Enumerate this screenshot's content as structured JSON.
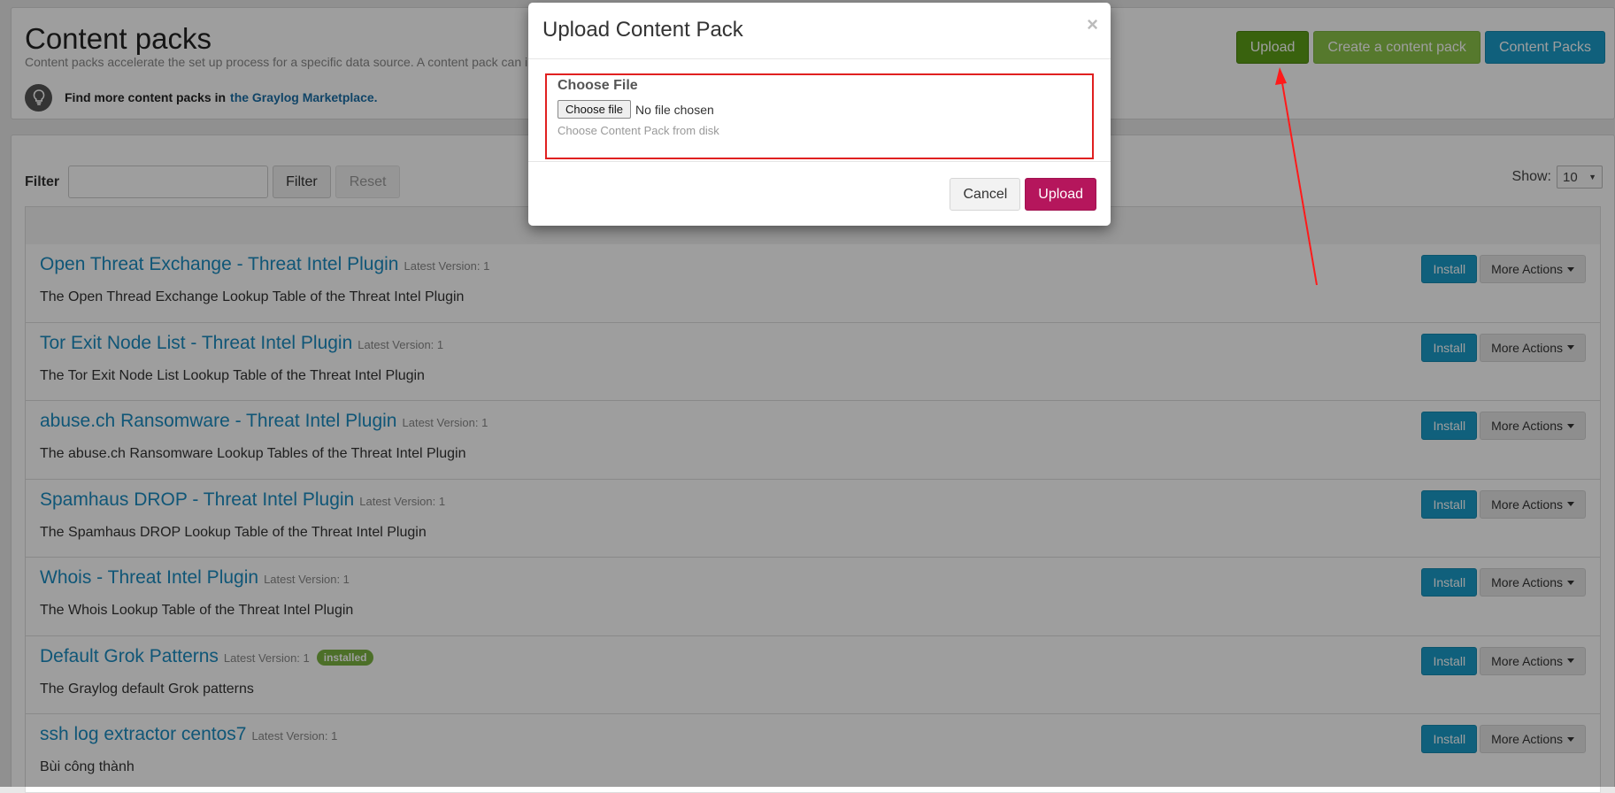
{
  "header": {
    "title": "Content packs",
    "description": "Content packs accelerate the set up process for a specific data source. A content pack can include inputs/extractors, streams, and dashboards.",
    "marketplace_text": "Find more content packs in",
    "marketplace_link": "the Graylog Marketplace.",
    "buttons": {
      "upload": "Upload",
      "create": "Create a content pack",
      "packs": "Content Packs"
    }
  },
  "filter": {
    "label": "Filter",
    "input_value": "",
    "filter_button": "Filter",
    "reset_button": "Reset",
    "show_label": "Show:",
    "show_value": "10"
  },
  "rows": [
    {
      "name": "Open Threat Exchange - Threat Intel Plugin",
      "version": "Latest Version: 1",
      "badge": "",
      "desc": "The Open Thread Exchange Lookup Table of the Threat Intel Plugin"
    },
    {
      "name": "Tor Exit Node List - Threat Intel Plugin",
      "version": "Latest Version: 1",
      "badge": "",
      "desc": "The Tor Exit Node List Lookup Table of the Threat Intel Plugin"
    },
    {
      "name": "abuse.ch Ransomware - Threat Intel Plugin",
      "version": "Latest Version: 1",
      "badge": "",
      "desc": "The abuse.ch Ransomware Lookup Tables of the Threat Intel Plugin"
    },
    {
      "name": "Spamhaus DROP - Threat Intel Plugin",
      "version": "Latest Version: 1",
      "badge": "",
      "desc": "The Spamhaus DROP Lookup Table of the Threat Intel Plugin"
    },
    {
      "name": "Whois - Threat Intel Plugin",
      "version": "Latest Version: 1",
      "badge": "",
      "desc": "The Whois Lookup Table of the Threat Intel Plugin"
    },
    {
      "name": "Default Grok Patterns",
      "version": "Latest Version: 1",
      "badge": "installed",
      "desc": "The Graylog default Grok patterns"
    },
    {
      "name": "ssh log extractor centos7",
      "version": "Latest Version: 1",
      "badge": "",
      "desc": "Bùi công thành"
    }
  ],
  "row_actions": {
    "install": "Install",
    "more": "More Actions"
  },
  "modal": {
    "title": "Upload Content Pack",
    "close": "×",
    "field_label": "Choose File",
    "file_button": "Choose file",
    "file_status": "No file chosen",
    "help": "Choose Content Pack from disk",
    "cancel": "Cancel",
    "upload": "Upload"
  },
  "colors": {
    "accent_blue": "#1a9bc8",
    "upload_pink": "#b5165c",
    "upload_green": "#5d9f17",
    "highlight_red": "#e02020"
  }
}
